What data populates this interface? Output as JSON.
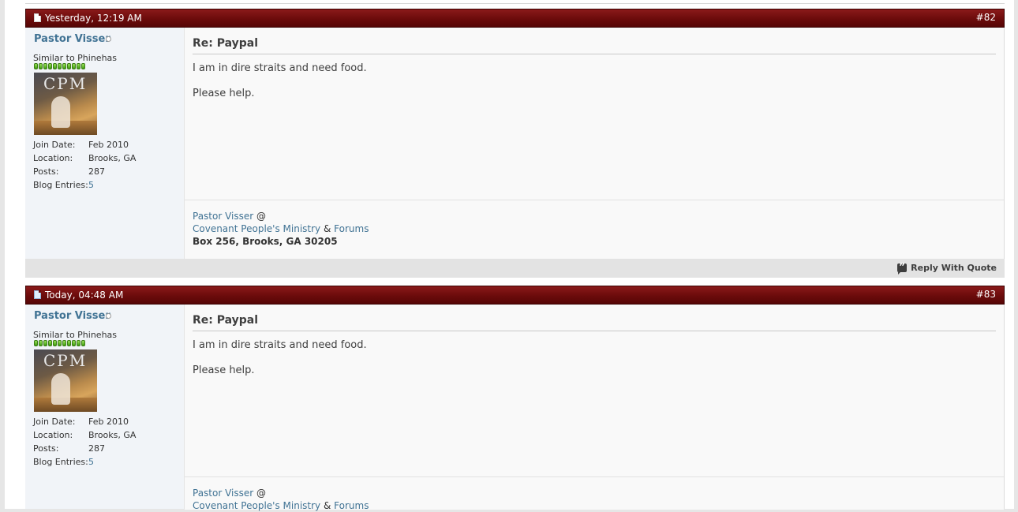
{
  "posts": [
    {
      "date": "Yesterday, 12:19 AM",
      "number": "#82",
      "user": {
        "name": "Pastor Visser",
        "title": "Similar to Phinehas",
        "avatar_text": "CPM",
        "stats": [
          {
            "label": "Join Date:",
            "value": "Feb 2010"
          },
          {
            "label": "Location:",
            "value": "Brooks, GA"
          },
          {
            "label": "Posts:",
            "value": "287"
          },
          {
            "label": "Blog Entries:",
            "value": "5"
          }
        ]
      },
      "title": "Re: Paypal",
      "lines": [
        "I am in dire straits and need food.",
        "Please help."
      ],
      "signature": {
        "name": "Pastor Visser",
        "at": "@",
        "ministry": "Covenant People's Ministry",
        "amp": "&",
        "forums": "Forums",
        "address": "Box 256, Brooks, GA 30205"
      },
      "reply_label": "Reply With Quote"
    },
    {
      "date": "Today, 04:48 AM",
      "number": "#83",
      "user": {
        "name": "Pastor Visser",
        "title": "Similar to Phinehas",
        "avatar_text": "CPM",
        "stats": [
          {
            "label": "Join Date:",
            "value": "Feb 2010"
          },
          {
            "label": "Location:",
            "value": "Brooks, GA"
          },
          {
            "label": "Posts:",
            "value": "287"
          },
          {
            "label": "Blog Entries:",
            "value": "5"
          }
        ]
      },
      "title": "Re: Paypal",
      "lines": [
        "I am in dire straits and need food.",
        "Please help."
      ],
      "signature": {
        "name": "Pastor Visser",
        "at": "@",
        "ministry": "Covenant People's Ministry",
        "amp": "&",
        "forums": "Forums"
      }
    }
  ],
  "colors": {
    "header": "#6b0b0b",
    "link": "#417394",
    "reputation": "#3e9b10"
  },
  "icons": {
    "post_status": "document-icon",
    "user_status": "offline-dot-icon",
    "reply": "quote-bubble-icon"
  },
  "reputation_level": 11
}
